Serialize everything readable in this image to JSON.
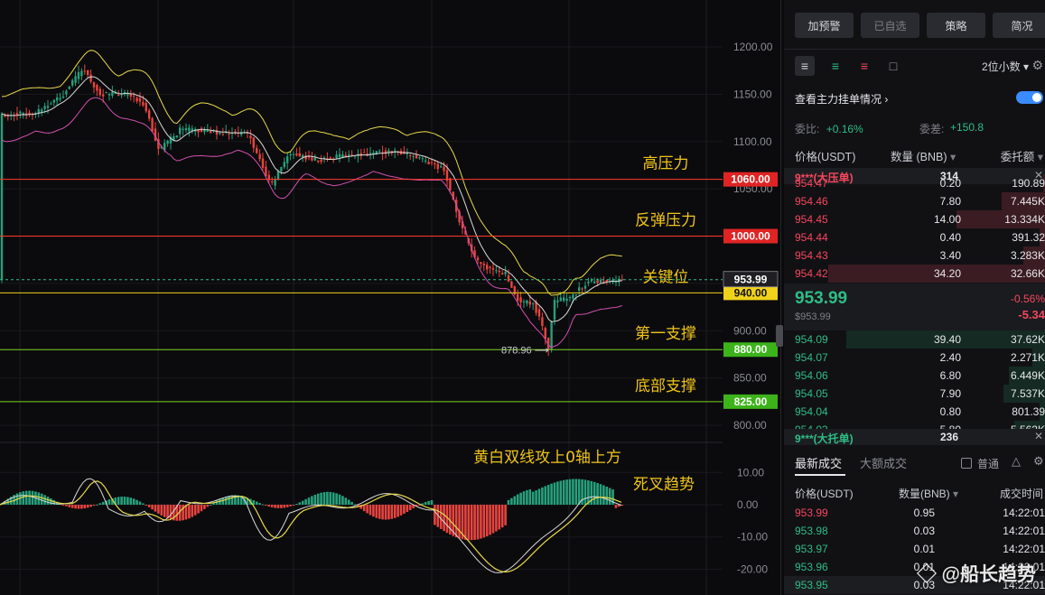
{
  "chart": {
    "price_axis": [
      "1200.00",
      "1150.00",
      "1100.00",
      "1050.00",
      "900.00",
      "850.00",
      "800.00"
    ],
    "indicator_axis": [
      "10.00",
      "0.00",
      "-10.00",
      "-20.00"
    ],
    "low_marker": "878.96",
    "levels": [
      {
        "label": "高压力",
        "tag": "1060.00",
        "price": 1060,
        "color": "#ff3b30",
        "tag_bg": "#e02424",
        "tag_fg": "#ffffff"
      },
      {
        "label": "反弹压力",
        "tag": "1000.00",
        "price": 1000,
        "color": "#ff3b30",
        "tag_bg": "#e02424",
        "tag_fg": "#ffffff"
      },
      {
        "label": "关键位",
        "tag": "940.00",
        "price": 940,
        "color": "#f0d21b",
        "tag_bg": "#f0d21b",
        "tag_fg": "#111111"
      },
      {
        "label": "第一支撑",
        "tag": "880.00",
        "price": 880,
        "color": "#7ed321",
        "tag_bg": "#3cb31a",
        "tag_fg": "#ffffff"
      },
      {
        "label": "底部支撑",
        "tag": "825.00",
        "price": 825,
        "color": "#7ed321",
        "tag_bg": "#3cb31a",
        "tag_fg": "#ffffff"
      }
    ],
    "current_price_tag": "953.99",
    "annotations": [
      "黄白双线攻上0轴上方",
      "死叉趋势"
    ],
    "colors": {
      "up": "#26a17b",
      "down": "#e8443f",
      "ma_white": "#d8d8d8",
      "boll_yellow": "#e8d84a",
      "boll_magenta": "#d24fb0",
      "label_yellow": "#f0c419"
    }
  },
  "panel": {
    "buttons": [
      "加预警",
      "已自选",
      "策略",
      "简况"
    ],
    "decimals": "2位小数",
    "depth_link": "查看主力挂单情况",
    "ratio_label": "委比:",
    "ratio_value": "+0.16%",
    "diff_label": "委差:",
    "diff_value": "+150.8",
    "col_price": "价格(USDT)",
    "col_qty": "数量 (BNB)",
    "col_total": "委托额",
    "big_ask_label": "9***(大压单)",
    "big_ask_qty": "314",
    "asks": [
      {
        "price": "954.47",
        "qty": "0.20",
        "total": "190.89"
      },
      {
        "price": "954.46",
        "qty": "7.80",
        "total": "7.445K"
      },
      {
        "price": "954.45",
        "qty": "14.00",
        "total": "13.334K"
      },
      {
        "price": "954.44",
        "qty": "0.40",
        "total": "391.32"
      },
      {
        "price": "954.43",
        "qty": "3.40",
        "total": "3.283K"
      },
      {
        "price": "954.42",
        "qty": "34.20",
        "total": "32.66K"
      }
    ],
    "last_price": "953.99",
    "last_price_sub": "$953.99",
    "change_pct": "-0.56%",
    "change_abs": "-5.34",
    "bids": [
      {
        "price": "954.09",
        "qty": "39.40",
        "total": "37.62K"
      },
      {
        "price": "954.07",
        "qty": "2.40",
        "total": "2.271K"
      },
      {
        "price": "954.06",
        "qty": "6.80",
        "total": "6.449K"
      },
      {
        "price": "954.05",
        "qty": "7.90",
        "total": "7.537K"
      },
      {
        "price": "954.04",
        "qty": "0.80",
        "total": "801.39"
      },
      {
        "price": "954.03",
        "qty": "5.80",
        "total": "5.562K"
      }
    ],
    "big_bid_label": "9***(大托单)",
    "big_bid_qty": "236",
    "tab_trades": "最新成交",
    "tab_big_trades": "大额成交",
    "normal_label": "普通",
    "trade_col_price": "价格(USDT)",
    "trade_col_qty": "数量(BNB)",
    "trade_col_time": "成交时间",
    "trades": [
      {
        "price": "953.99",
        "qty": "0.95",
        "time": "14:22:01",
        "side": "sell"
      },
      {
        "price": "953.98",
        "qty": "0.03",
        "time": "14:22:01",
        "side": "buy"
      },
      {
        "price": "953.97",
        "qty": "0.01",
        "time": "14:22:01",
        "side": "buy"
      },
      {
        "price": "953.96",
        "qty": "0.01",
        "time": "14:22:01",
        "side": "buy"
      },
      {
        "price": "953.95",
        "qty": "0.03",
        "time": "14:22:01",
        "side": "buy"
      }
    ]
  },
  "watermark": "@船长趋势"
}
